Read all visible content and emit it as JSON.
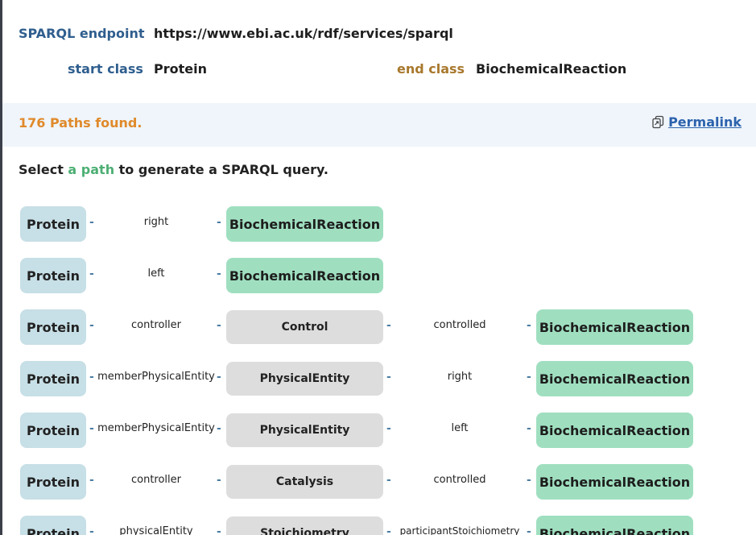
{
  "endpoint": {
    "label": "SPARQL endpoint",
    "url": "https://www.ebi.ac.uk/rdf/services/sparql"
  },
  "classes": {
    "start_label": "start class",
    "start_value": "Protein",
    "end_label": "end class",
    "end_value": "BiochemicalReaction"
  },
  "results": {
    "found_text": "176 Paths found.",
    "permalink_label": "Permalink"
  },
  "hint": {
    "before": "Select ",
    "highlight": "a path",
    "after": " to generate a SPARQL query."
  },
  "dash": "-",
  "paths": [
    {
      "start": "Protein",
      "edge1": "right",
      "end": "BiochemicalReaction"
    },
    {
      "start": "Protein",
      "edge1": "left",
      "end": "BiochemicalReaction"
    },
    {
      "start": "Protein",
      "edge1": "controller",
      "mid": "Control",
      "edge2": "controlled",
      "end": "BiochemicalReaction"
    },
    {
      "start": "Protein",
      "edge1": "memberPhysicalEntity",
      "mid": "PhysicalEntity",
      "edge2": "right",
      "end": "BiochemicalReaction"
    },
    {
      "start": "Protein",
      "edge1": "memberPhysicalEntity",
      "mid": "PhysicalEntity",
      "edge2": "left",
      "end": "BiochemicalReaction"
    },
    {
      "start": "Protein",
      "edge1": "controller",
      "mid": "Catalysis",
      "edge2": "controlled",
      "end": "BiochemicalReaction"
    },
    {
      "start": "Protein",
      "edge1": "physicalEntity",
      "mid": "Stoichiometry",
      "edge2": "participantStoichiometry",
      "end": "BiochemicalReaction"
    }
  ]
}
